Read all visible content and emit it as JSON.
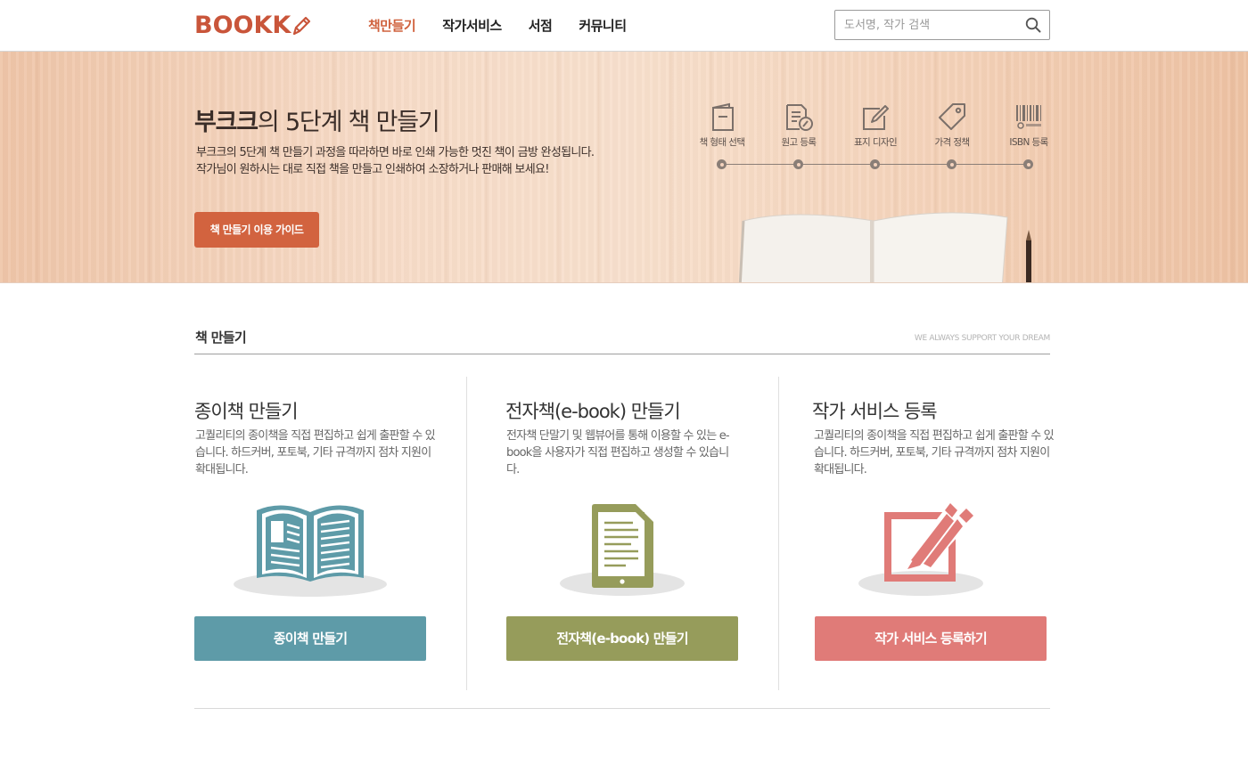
{
  "header": {
    "logo": "BOOKK",
    "nav": [
      {
        "label": "책만들기",
        "active": true
      },
      {
        "label": "작가서비스",
        "active": false
      },
      {
        "label": "서점",
        "active": false
      },
      {
        "label": "커뮤니티",
        "active": false
      }
    ],
    "search": {
      "placeholder": "도서명, 작가 검색",
      "icon": "search-icon"
    }
  },
  "hero": {
    "title_strong": "부크크",
    "title_rest": "의 5단계 책 만들기",
    "desc_line1": "부크크의 5단계 책 만들기 과정을 따라하면 바로 인쇄 가능한 멋진 책이 금방 완성됩니다.",
    "desc_line2": "작가님이 원하시는 대로 직접 책을 만들고 인쇄하여 소장하거나 판매해 보세요!",
    "guide_button": "책 만들기 이용 가이드",
    "steps": [
      {
        "label": "책 형태 선택",
        "icon": "book-shape-icon"
      },
      {
        "label": "원고 등록",
        "icon": "manuscript-icon"
      },
      {
        "label": "표지 디자인",
        "icon": "cover-edit-icon"
      },
      {
        "label": "가격 정책",
        "icon": "price-tag-icon"
      },
      {
        "label": "ISBN 등록",
        "icon": "barcode-icon"
      }
    ]
  },
  "section": {
    "title": "책 만들기",
    "tagline": "WE ALWAYS SUPPORT YOUR DREAM"
  },
  "cards": [
    {
      "title": "종이책 만들기",
      "desc": "고퀄리티의 종이책을 직접 편집하고 쉽게 출판할 수 있습니다. 하드커버, 포토북, 기타 규격까지 점차 지원이 확대됩니다.",
      "button": "종이책 만들기",
      "color": "#5e9ba8",
      "icon": "open-book-icon"
    },
    {
      "title": "전자책(e-book) 만들기",
      "desc": "전자책 단말기 및 웹뷰어를 통해 이용할 수 있는 e-book을 사용자가 직접 편집하고 생성할 수 있습니다.",
      "button": "전자책(e-book) 만들기",
      "color": "#969c5b",
      "icon": "tablet-document-icon"
    },
    {
      "title": "작가 서비스 등록",
      "desc": "고퀄리티의 종이책을 직접 편집하고 쉽게 출판할 수 있습니다. 하드커버, 포토북, 기타 규격까지 점차 지원이 확대됩니다.",
      "button": "작가 서비스 등록하기",
      "color": "#e07b78",
      "icon": "pen-brush-icon"
    }
  ]
}
